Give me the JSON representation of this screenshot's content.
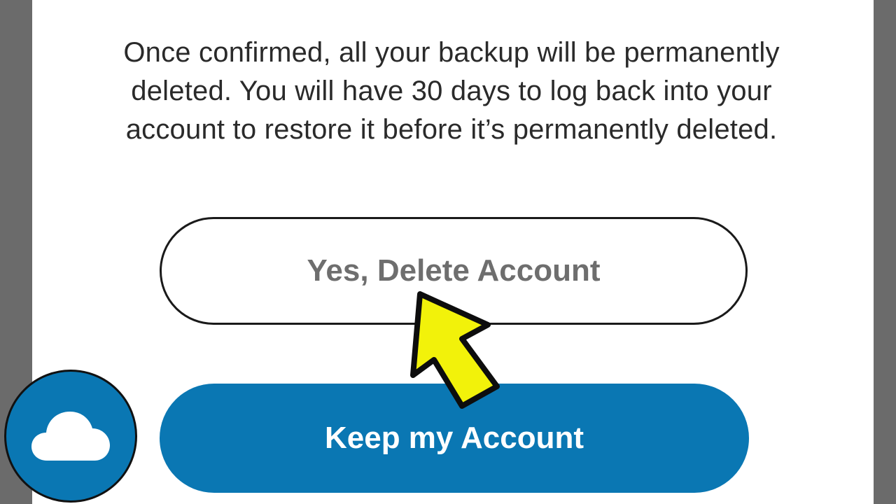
{
  "dialog": {
    "message_lines": [
      "Once confirmed, all your backup will be permanently",
      "deleted. You will have 30 days to log back into your",
      "account to restore it before it’s permanently deleted."
    ],
    "delete_button_label": "Yes, Delete Account",
    "keep_button_label": "Keep my Account"
  },
  "overlay": {
    "pointer_icon": "arrow-pointer-icon",
    "pointer_color": "#f2f20a",
    "logo_icon": "cloud-icon"
  },
  "colors": {
    "primary": "#0a77b3",
    "delete_text": "#6e6e6e",
    "background_frame": "#6b6b6b"
  }
}
